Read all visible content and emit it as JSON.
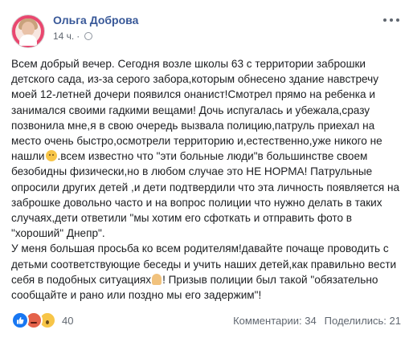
{
  "post": {
    "author": "Ольга Доброва",
    "time": "14 ч.",
    "time_separator": "·",
    "paragraph1_a": "Всем добрый вечер. Сегодня возле школы 63 с территории заброшки детского сада, из-за серого забора,которым обнесено здание навстречу моей 12-летней дочери появился онанист!Смотрел прямо на ребенка и занимался своими гадкими вещами! Дочь испугалась и убежала,сразу позвонила мне,я в свою очередь вызвала полицию,патруль приехал на место очень быстро,осмотрели территорию и,естественно,уже никого не нашли",
    "paragraph1_b": ".всем известно что \"эти больные люди\"в большинстве своем безобидны физически,но в любом случае это НЕ НОРМА! Патрульные опросили других детей ,и дети подтвердили что эта личность появляется на заброшке довольно часто и на вопрос полиции что нужно делать в таких случаях,дети ответили \"мы хотим его сфоткать и отправить фото в \"хороший\" Днепр\".",
    "paragraph2_a": "У меня большая просьба ко всем родителям!давайте почаще проводить с детьми соответствующие беседы и учить наших детей,как правильно вести себя в подобных ситуациях",
    "paragraph2_b": "! Призыв полиции был такой \"обязательно сообщайте и рано или поздно мы его задержим\"!"
  },
  "icons": {
    "more": "more-horizontal-icon",
    "privacy": "globe-icon",
    "emoji1": "sad-face-emoji",
    "emoji2": "praying-hands-emoji"
  },
  "footer": {
    "reactions": [
      "like",
      "angry",
      "wow"
    ],
    "reaction_count": "40",
    "comments": "Комментарии: 34",
    "shares": "Поделились: 21"
  },
  "colors": {
    "author": "#385898",
    "meta": "#606770",
    "like": "#1877f2",
    "angry": "#e4624a",
    "wow": "#f7c548"
  }
}
